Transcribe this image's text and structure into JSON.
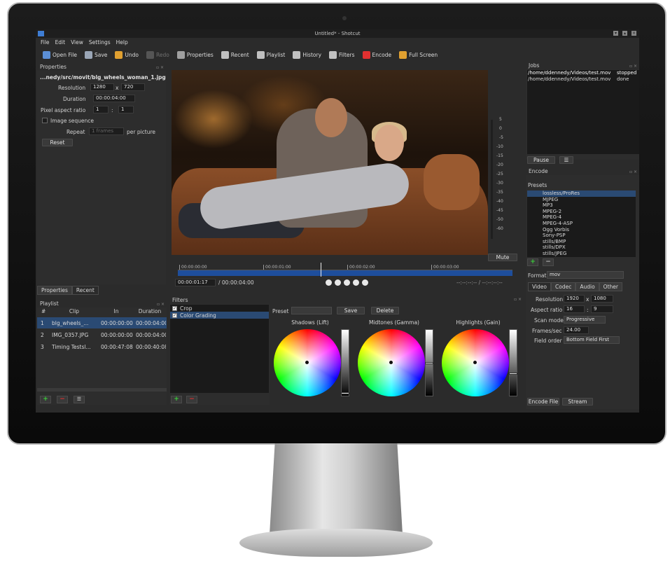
{
  "window": {
    "title": "Untitled* - Shotcut"
  },
  "menu": [
    "File",
    "Edit",
    "View",
    "Settings",
    "Help"
  ],
  "toolbar": [
    {
      "label": "Open File",
      "icon": "folder-icon",
      "color": "#5c8fd6",
      "disabled": false
    },
    {
      "label": "Save",
      "icon": "save-icon",
      "color": "#9aa6b6",
      "disabled": false
    },
    {
      "label": "Undo",
      "icon": "undo-icon",
      "color": "#e0a030",
      "disabled": false
    },
    {
      "label": "Redo",
      "icon": "redo-icon",
      "color": "#555555",
      "disabled": true
    },
    {
      "label": "Properties",
      "icon": "properties-icon",
      "color": "#a0a0a0",
      "disabled": false
    },
    {
      "label": "Recent",
      "icon": "recent-icon",
      "color": "#c0c0c0",
      "disabled": false
    },
    {
      "label": "Playlist",
      "icon": "playlist-icon",
      "color": "#c0c0c0",
      "disabled": false
    },
    {
      "label": "History",
      "icon": "history-icon",
      "color": "#c0c0c0",
      "disabled": false
    },
    {
      "label": "Filters",
      "icon": "filters-icon",
      "color": "#c0c0c0",
      "disabled": false
    },
    {
      "label": "Encode",
      "icon": "encode-icon",
      "color": "#e03030",
      "disabled": false
    },
    {
      "label": "Full Screen",
      "icon": "fullscreen-icon",
      "color": "#e0a030",
      "disabled": false
    }
  ],
  "properties": {
    "header": "Properties",
    "filename": "...nedy/src/movit/blg_wheels_woman_1.jpg",
    "resolution_label": "Resolution",
    "res_w": "1280",
    "res_x": "x",
    "res_h": "720",
    "duration_label": "Duration",
    "duration": "00:00:04:00",
    "par_label": "Pixel aspect ratio",
    "par_w": "1",
    "par_sep": ":",
    "par_h": "1",
    "image_seq_label": "Image sequence",
    "repeat_label": "Repeat",
    "repeat_value": "1 frames",
    "per_picture": "per picture",
    "reset": "Reset"
  },
  "left_tabs": [
    "Properties",
    "Recent"
  ],
  "playlist": {
    "header": "Playlist",
    "columns": [
      "#",
      "Clip",
      "In",
      "Duration"
    ],
    "rows": [
      {
        "n": "1",
        "clip": "blg_wheels_...",
        "in": "00:00:00:00",
        "duration": "00:00:04:00",
        "selected": true
      },
      {
        "n": "2",
        "clip": "IMG_0357.JPG",
        "in": "00:00:00:00",
        "duration": "00:00:04:00",
        "selected": false
      },
      {
        "n": "3",
        "clip": "Timing Testsl...",
        "in": "00:00:47:08",
        "duration": "00:00:40:08",
        "selected": false
      }
    ],
    "menu_glyph": "☰"
  },
  "meter": {
    "ticks": [
      "5",
      "0",
      "-5",
      "-10",
      "-15",
      "-20",
      "-25",
      "-30",
      "-35",
      "-40",
      "-45",
      "-50",
      "-60"
    ],
    "mute": "Mute"
  },
  "timeline": {
    "ticks": [
      "00:00:00:00",
      "00:00:01:00",
      "00:00:02:00",
      "00:00:03:00"
    ],
    "position": "00:00:01:17",
    "total": "/ 00:00:04:00",
    "in_out": "--:--:--:-- / --:--:--:--"
  },
  "jobs": {
    "header": "Jobs",
    "items": [
      {
        "path": "/home/ddennedy/Videos/test.mov",
        "status": "stopped",
        "selected": true
      },
      {
        "path": "/home/ddennedy/Videos/test.mov",
        "status": "done",
        "selected": false
      }
    ],
    "pause": "Pause",
    "menu_glyph": "☰"
  },
  "encode": {
    "header": "Encode",
    "presets_label": "Presets",
    "presets": [
      "lossless/ProRes",
      "MJPEG",
      "MP3",
      "MPEG-2",
      "MPEG-4",
      "MPEG-4-ASP",
      "Ogg Vorbis",
      "Sony-PSP",
      "stills/BMP",
      "stills/DPX",
      "stills/JPEG"
    ],
    "selected_preset": 0,
    "format_label": "Format",
    "format_value": "mov",
    "tabs": [
      "Video",
      "Codec",
      "Audio",
      "Other"
    ],
    "resolution_label": "Resolution",
    "res_w": "1920",
    "res_x": "x",
    "res_h": "1080",
    "aspect_label": "Aspect ratio",
    "aspect_w": "16",
    "aspect_sep": ":",
    "aspect_h": "9",
    "scan_label": "Scan mode",
    "scan_value": "Progressive",
    "fps_label": "Frames/sec",
    "fps_value": "24.00",
    "field_label": "Field order",
    "field_value": "Bottom Field First",
    "encode_file": "Encode File",
    "stream": "Stream"
  },
  "filters": {
    "header": "Filters",
    "items": [
      {
        "label": "Crop",
        "checked": true,
        "selected": false
      },
      {
        "label": "Color Grading",
        "checked": true,
        "selected": true
      }
    ]
  },
  "grading": {
    "preset_label": "Preset",
    "preset_value": "",
    "save": "Save",
    "delete": "Delete",
    "wheels": [
      {
        "label": "Shadows (Lift)",
        "level": 0.03
      },
      {
        "label": "Midtones (Gamma)",
        "level": 0.5
      },
      {
        "label": "Highlights (Gain)",
        "level": 0.34
      }
    ]
  }
}
